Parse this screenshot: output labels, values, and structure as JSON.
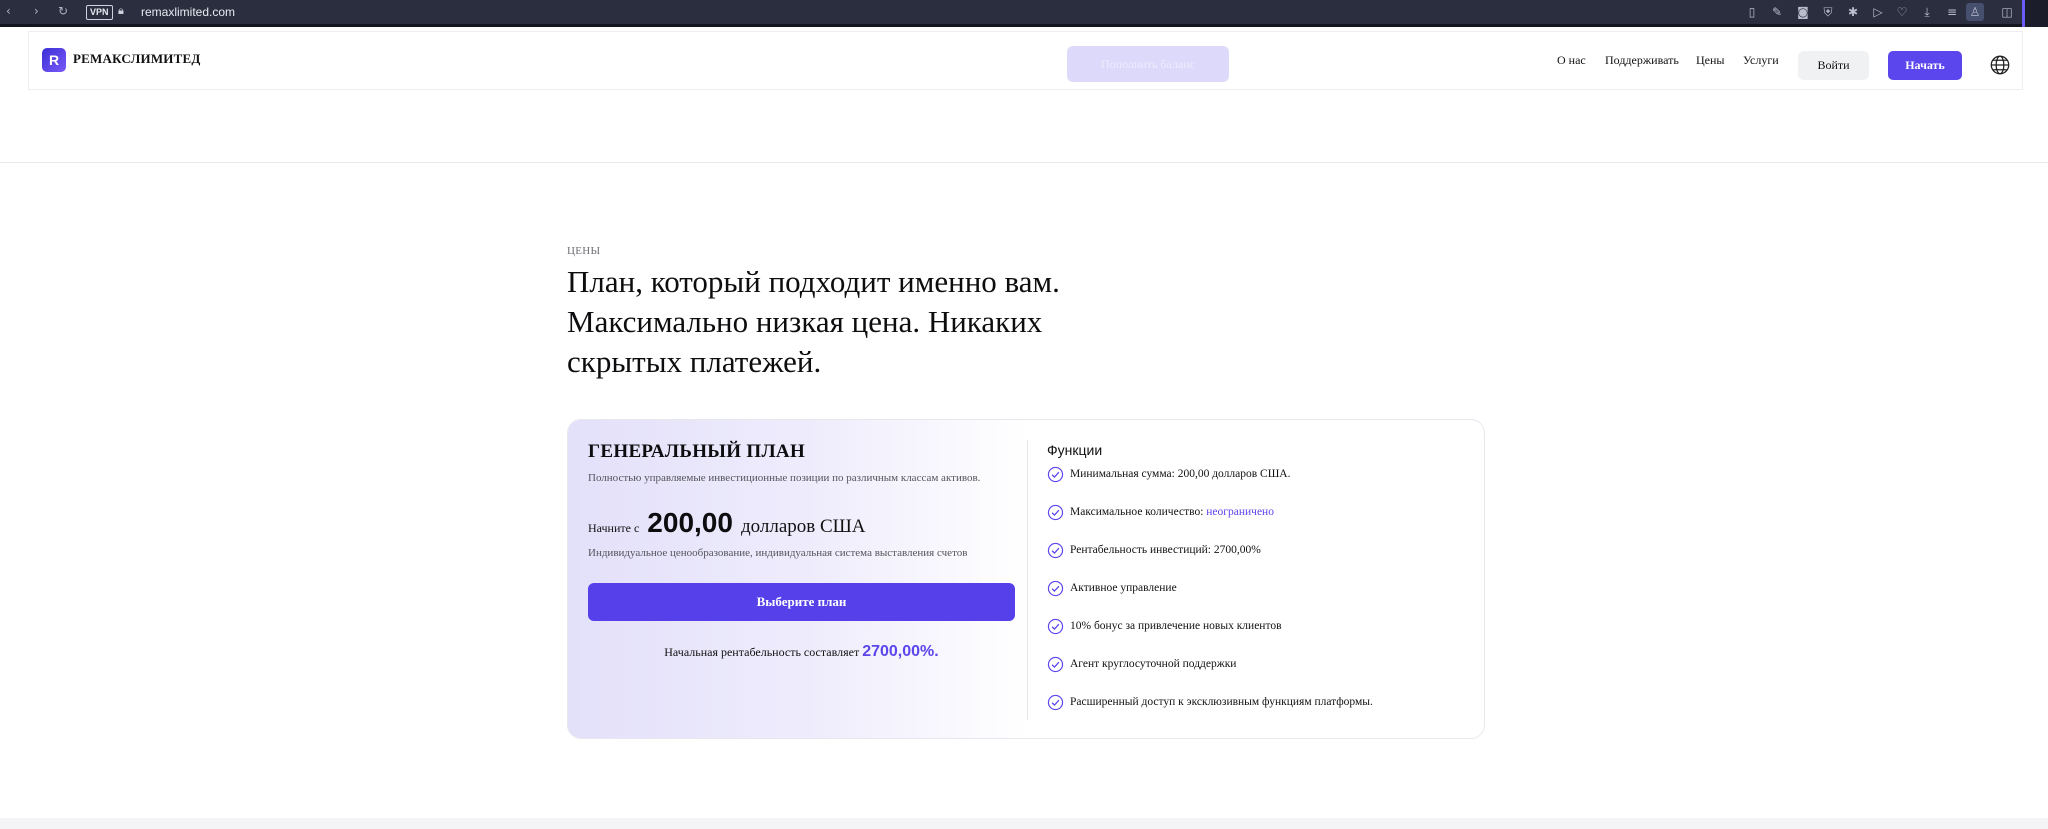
{
  "browser": {
    "url": "remaxlimited.com",
    "vpn_label": "VPN",
    "icons": [
      "back-icon",
      "forward-icon",
      "reload-icon",
      "vpn-badge",
      "lock-icon",
      "reader-icon",
      "edit-icon",
      "camera-icon",
      "shield-icon",
      "extension-icon",
      "play-icon",
      "heart-icon",
      "download-icon",
      "menu-icon",
      "profile-icon",
      "box-icon"
    ]
  },
  "header": {
    "logo_letter": "R",
    "logo_text": "РЕМАКСЛИМИТЕД",
    "ghost_label": "Пополнить баланс",
    "nav": [
      "О нас",
      "Поддерживать",
      "Цены",
      "Услуги"
    ],
    "login_label": "Войти",
    "start_label": "Начать"
  },
  "hero": {
    "eyebrow": "ЦЕНЫ",
    "title": "План, который подходит именно вам. Максимально низкая цена. Никаких скрытых платежей."
  },
  "plan": {
    "name": "ГЕНЕРАЛЬНЫЙ ПЛАН",
    "description": "Полностью управляемые инвестиционные позиции по различным классам активов.",
    "price_prefix": "Начните с",
    "price_value": "200,00",
    "price_currency": "долларов США",
    "price_note": "Индивидуальное ценообразование, индивидуальная система выставления счетов",
    "button_label": "Выберите план",
    "roi_text": "Начальная рентабельность составляет",
    "roi_value": "2700,00%."
  },
  "features": {
    "title": "Функции",
    "items": [
      {
        "text": "Минимальная сумма: 200,00 долларов США.",
        "link": ""
      },
      {
        "text": "Максимальное количество: ",
        "link": "неограничено"
      },
      {
        "text": "Рентабельность инвестиций: 2700,00%",
        "link": ""
      },
      {
        "text": "Активное управление",
        "link": ""
      },
      {
        "text": "10% бонус за привлечение новых клиентов",
        "link": ""
      },
      {
        "text": "Агент круглосуточной поддержки",
        "link": ""
      },
      {
        "text": "Расширенный доступ к эксклюзивным функциям платформы.",
        "link": ""
      }
    ]
  },
  "colors": {
    "accent": "#5b45ec",
    "chrome": "#2b2e3f"
  }
}
